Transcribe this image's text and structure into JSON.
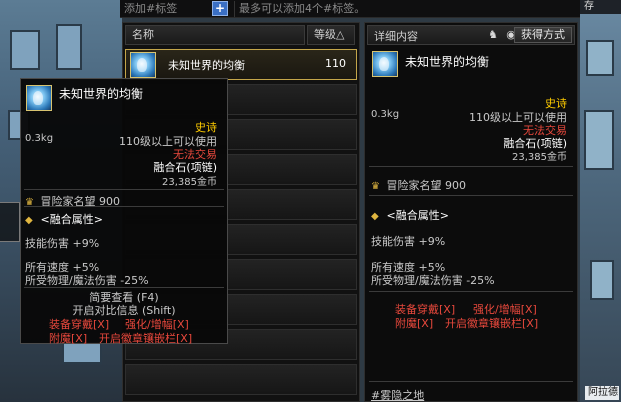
{
  "tagbar": {
    "placeholder": "添加#标签",
    "add_label": "+",
    "limit_text": "最多可以添加4个#标签。"
  },
  "list": {
    "col_name": "名称",
    "col_level": "等级△",
    "rows": [
      {
        "name": "未知世界的均衡",
        "level": "110",
        "selected": true
      }
    ]
  },
  "detail": {
    "header": "详细内容",
    "source_button": "获得方式",
    "item_name": "未知世界的均衡",
    "rarity": "史诗",
    "weight": "0.3kg",
    "level_req": "110级以上可以使用",
    "trade": "无法交易",
    "type": "融合石(项链)",
    "price": "23,385金币",
    "fame_label": "冒险家名望",
    "fame_value": "900",
    "fusion_title": "<融合属性>",
    "stat1": "技能伤害 +9%",
    "stat2": "所有速度 +5%",
    "stat3": "所受物理/魔法伤害 -25%",
    "equip_wear": "装备穿戴[X]",
    "enhance": "强化/增幅[X]",
    "enchant": "附魔[X]",
    "emblem": "开启徽章镶嵌栏[X]",
    "location": "#雾隐之地"
  },
  "tooltip": {
    "item_name": "未知世界的均衡",
    "rarity": "史诗",
    "weight": "0.3kg",
    "level_req": "110级以上可以使用",
    "trade": "无法交易",
    "type": "融合石(项链)",
    "price": "23,385金币",
    "fame_label": "冒险家名望",
    "fame_value": "900",
    "fusion_title": "<融合属性>",
    "stat1": "技能伤害 +9%",
    "stat2": "所有速度 +5%",
    "stat3": "所受物理/魔法伤害 -25%",
    "brief": "简要查看 (F4)",
    "compare": "开启对比信息 (Shift)",
    "equip_wear": "装备穿戴[X]",
    "enhance": "强化/增幅[X]",
    "enchant": "附魔[X]",
    "emblem": "开启徽章镶嵌栏[X]"
  },
  "scene": {
    "corner_label": "阿拉德",
    "top_corner": "存"
  },
  "colors": {
    "rarity": "#ffcc00",
    "unusable": "#e8483c"
  }
}
